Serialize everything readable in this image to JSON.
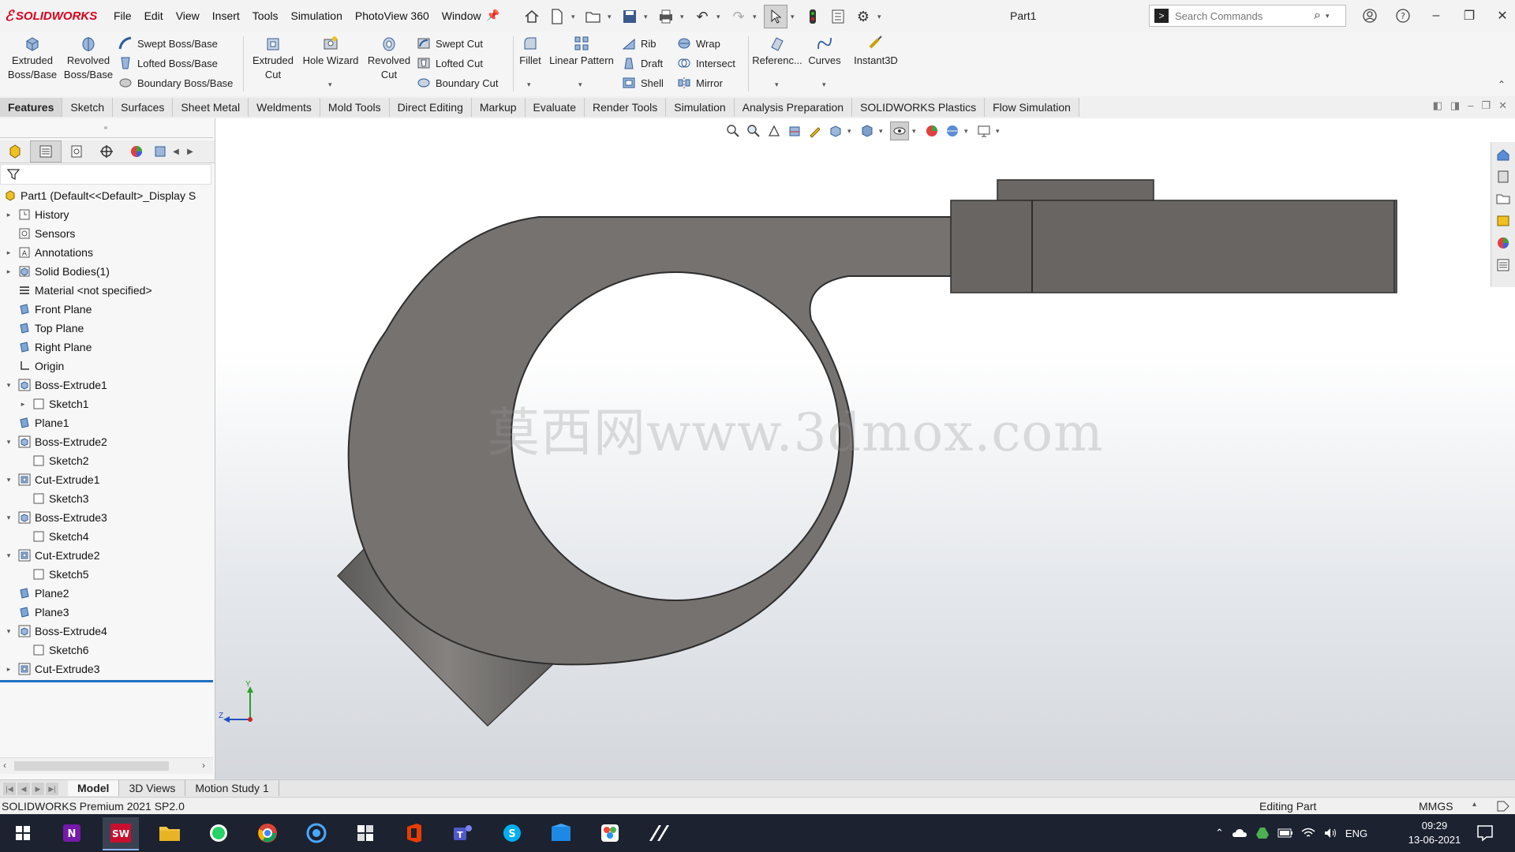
{
  "app": {
    "brand": "SOLIDWORKS",
    "document_title": "Part1"
  },
  "menu": [
    "File",
    "Edit",
    "View",
    "Insert",
    "Tools",
    "Simulation",
    "PhotoView 360",
    "Window"
  ],
  "search": {
    "placeholder": "Search Commands"
  },
  "ribbon": {
    "extruded_boss": "Extruded Boss/Base",
    "extruded_boss_l1": "Extruded",
    "extruded_boss_l2": "Boss/Base",
    "revolved_boss_l1": "Revolved",
    "revolved_boss_l2": "Boss/Base",
    "swept_boss": "Swept Boss/Base",
    "lofted_boss": "Lofted Boss/Base",
    "boundary_boss": "Boundary Boss/Base",
    "extruded_cut_l1": "Extruded",
    "extruded_cut_l2": "Cut",
    "hole_wizard": "Hole Wizard",
    "revolved_cut_l1": "Revolved",
    "revolved_cut_l2": "Cut",
    "swept_cut": "Swept Cut",
    "lofted_cut": "Lofted Cut",
    "boundary_cut": "Boundary Cut",
    "fillet": "Fillet",
    "linear_pattern": "Linear Pattern",
    "rib": "Rib",
    "draft": "Draft",
    "shell": "Shell",
    "wrap": "Wrap",
    "intersect": "Intersect",
    "mirror": "Mirror",
    "reference": "Referenc...",
    "curves": "Curves",
    "instant3d": "Instant3D"
  },
  "tabs": [
    "Features",
    "Sketch",
    "Surfaces",
    "Sheet Metal",
    "Weldments",
    "Mold Tools",
    "Direct Editing",
    "Markup",
    "Evaluate",
    "Render Tools",
    "Simulation",
    "Analysis Preparation",
    "SOLIDWORKS Plastics",
    "Flow Simulation"
  ],
  "tree": [
    {
      "label": "Part1  (Default<<Default>_Display S",
      "icon": "part-icon",
      "level": 0,
      "expander": ""
    },
    {
      "label": "History",
      "icon": "history-icon",
      "level": 1,
      "expander": "collapsed"
    },
    {
      "label": "Sensors",
      "icon": "sensors-icon",
      "level": 1,
      "expander": ""
    },
    {
      "label": "Annotations",
      "icon": "annotations-icon",
      "level": 1,
      "expander": "collapsed"
    },
    {
      "label": "Solid Bodies(1)",
      "icon": "solid-bodies-icon",
      "level": 1,
      "expander": "collapsed"
    },
    {
      "label": "Material <not specified>",
      "icon": "material-icon",
      "level": 1,
      "expander": ""
    },
    {
      "label": "Front Plane",
      "icon": "plane-icon",
      "level": 1,
      "expander": ""
    },
    {
      "label": "Top Plane",
      "icon": "plane-icon",
      "level": 1,
      "expander": ""
    },
    {
      "label": "Right Plane",
      "icon": "plane-icon",
      "level": 1,
      "expander": ""
    },
    {
      "label": "Origin",
      "icon": "origin-icon",
      "level": 1,
      "expander": ""
    },
    {
      "label": "Boss-Extrude1",
      "icon": "boss-extrude-icon",
      "level": 1,
      "expander": "expanded"
    },
    {
      "label": "Sketch1",
      "icon": "sketch-icon",
      "level": 2,
      "expander": "collapsed"
    },
    {
      "label": "Plane1",
      "icon": "plane-icon",
      "level": 1,
      "expander": ""
    },
    {
      "label": "Boss-Extrude2",
      "icon": "boss-extrude-icon",
      "level": 1,
      "expander": "expanded"
    },
    {
      "label": "Sketch2",
      "icon": "sketch-icon",
      "level": 2,
      "expander": ""
    },
    {
      "label": "Cut-Extrude1",
      "icon": "cut-extrude-icon",
      "level": 1,
      "expander": "expanded"
    },
    {
      "label": "Sketch3",
      "icon": "sketch-icon",
      "level": 2,
      "expander": ""
    },
    {
      "label": "Boss-Extrude3",
      "icon": "boss-extrude-icon",
      "level": 1,
      "expander": "expanded"
    },
    {
      "label": "Sketch4",
      "icon": "sketch-icon",
      "level": 2,
      "expander": ""
    },
    {
      "label": "Cut-Extrude2",
      "icon": "cut-extrude-icon",
      "level": 1,
      "expander": "expanded"
    },
    {
      "label": "Sketch5",
      "icon": "sketch-icon",
      "level": 2,
      "expander": ""
    },
    {
      "label": "Plane2",
      "icon": "plane-icon",
      "level": 1,
      "expander": ""
    },
    {
      "label": "Plane3",
      "icon": "plane-icon",
      "level": 1,
      "expander": ""
    },
    {
      "label": "Boss-Extrude4",
      "icon": "boss-extrude-icon",
      "level": 1,
      "expander": "expanded"
    },
    {
      "label": "Sketch6",
      "icon": "sketch-icon",
      "level": 2,
      "expander": ""
    },
    {
      "label": "Cut-Extrude3",
      "icon": "cut-extrude-icon",
      "level": 1,
      "expander": "collapsed"
    }
  ],
  "watermark": "莫西网www.3dmox.com",
  "triad": {
    "y": "Y",
    "z": "Z"
  },
  "bottom_tabs": [
    "Model",
    "3D Views",
    "Motion Study 1"
  ],
  "status": {
    "version": "SOLIDWORKS Premium 2021 SP2.0",
    "mode": "Editing Part",
    "units": "MMGS"
  },
  "taskbar": {
    "lang": "ENG",
    "time": "09:29",
    "date": "13-06-2021",
    "apps": [
      "windows-start-icon",
      "onenote-icon",
      "solidworks-icon",
      "file-explorer-icon",
      "whatsapp-icon",
      "chrome-icon",
      "browser-icon",
      "app-icon",
      "office-icon",
      "teams-icon",
      "skype-icon",
      "media-icon",
      "photos-icon",
      "app2-icon"
    ]
  },
  "colors": {
    "brand": "#d8001b",
    "part_gray": "#767270",
    "selection_blue": "#1f6fc1",
    "taskbar": "#1c2230"
  }
}
